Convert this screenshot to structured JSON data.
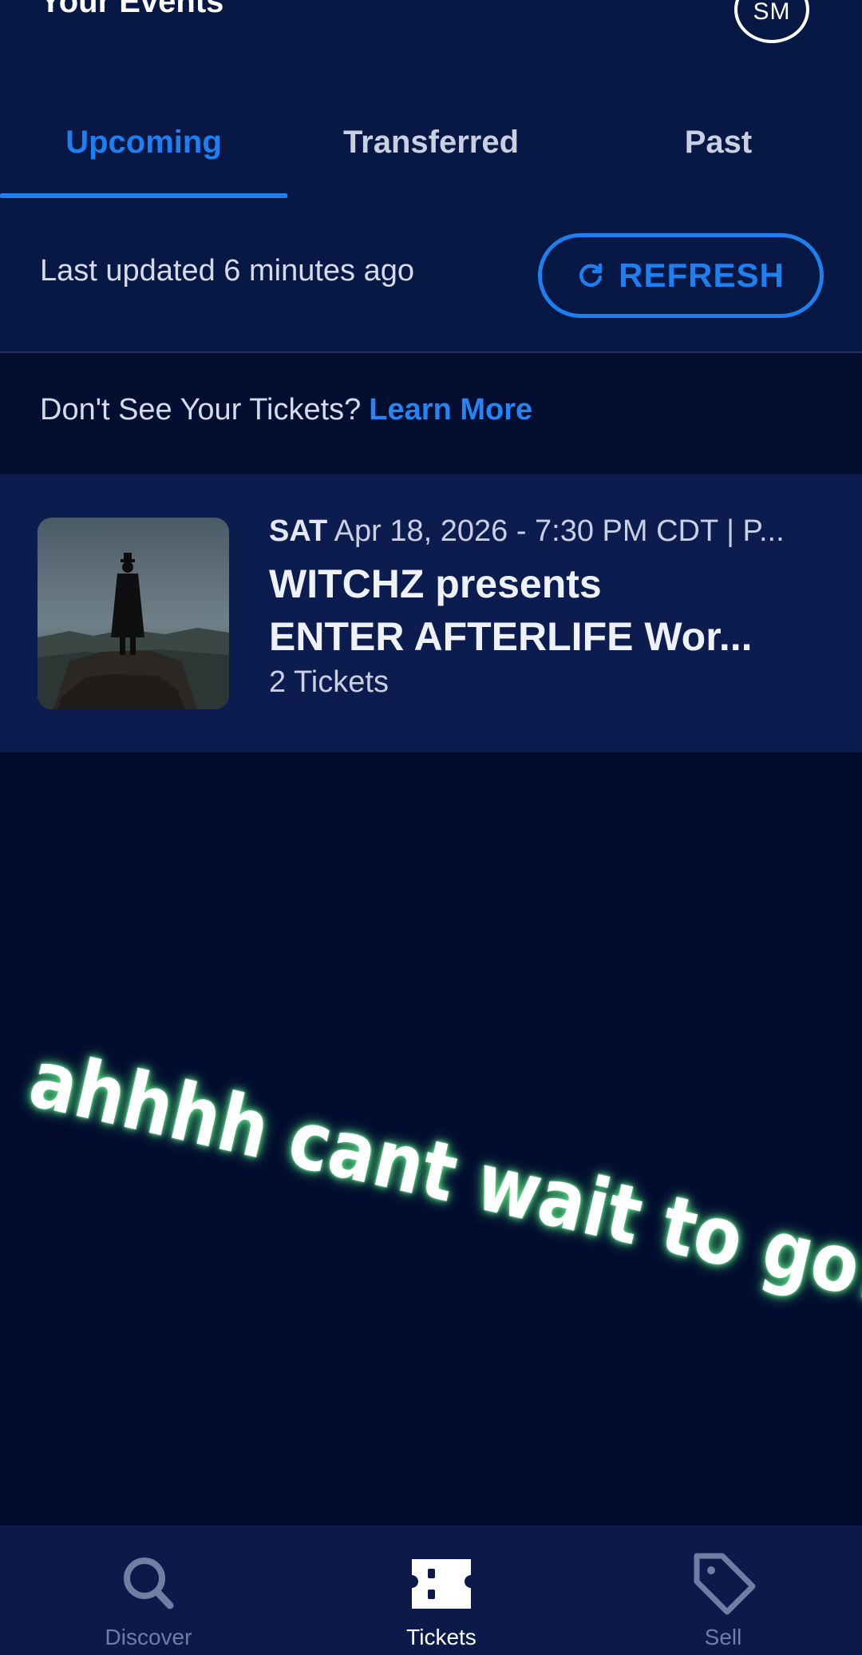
{
  "header": {
    "title": "Your Events",
    "avatar_initials": "SM"
  },
  "tabs": [
    {
      "label": "Upcoming",
      "active": true
    },
    {
      "label": "Transferred",
      "active": false
    },
    {
      "label": "Past",
      "active": false
    }
  ],
  "status": {
    "last_updated": "Last updated 6 minutes ago",
    "refresh_label": "REFRESH"
  },
  "notice": {
    "text": "Don't See Your Tickets?",
    "link": "Learn More"
  },
  "events": [
    {
      "day": "SAT",
      "datetime": "Apr 18, 2026 - 7:30 PM CDT | P...",
      "title_line1": "WITCHZ presents",
      "title_line2": "ENTER AFTERLIFE Wor...",
      "tickets": "2 Tickets"
    }
  ],
  "overlay": {
    "caption": "ahhhh cant wait to go!!"
  },
  "bottom_nav": [
    {
      "label": "Discover",
      "icon": "search-icon",
      "active": false
    },
    {
      "label": "Tickets",
      "icon": "ticket-icon",
      "active": true
    },
    {
      "label": "Sell",
      "icon": "tag-icon",
      "active": false
    }
  ],
  "colors": {
    "accent": "#1e7ff0",
    "background": "#020b2e",
    "header": "#081844",
    "card": "#0c1c4e"
  }
}
